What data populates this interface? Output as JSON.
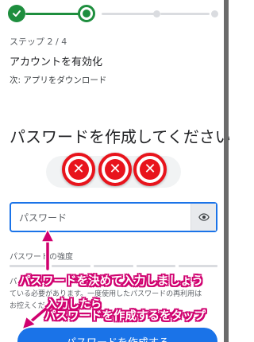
{
  "stepper": {
    "steps": [
      "done",
      "current",
      "todo",
      "todo"
    ]
  },
  "step": {
    "count": "ステップ 2 / 4",
    "title": "アカウントを有効化",
    "next": "次: アプリをダウンロード"
  },
  "main": {
    "heading": "パスワードを作成してください"
  },
  "password": {
    "placeholder": "パスワード",
    "value": "",
    "eye_icon": "eye-icon"
  },
  "strength": {
    "label": "パスワードの強度",
    "bars": 5
  },
  "help": {
    "line1": "パ",
    "line2": "ている必要があります。一度使用したパスワードの再利用は",
    "line3": "お控えくだ"
  },
  "create_button": {
    "label": "パスワードを作成する"
  },
  "annotations": {
    "ann1": "パスワードを決めて入力しましょう",
    "ann2": "入力したら",
    "ann3": "パスワードを作成するをタップ",
    "arrow_color": "#d0006f",
    "mark_color": "#e8141c"
  }
}
